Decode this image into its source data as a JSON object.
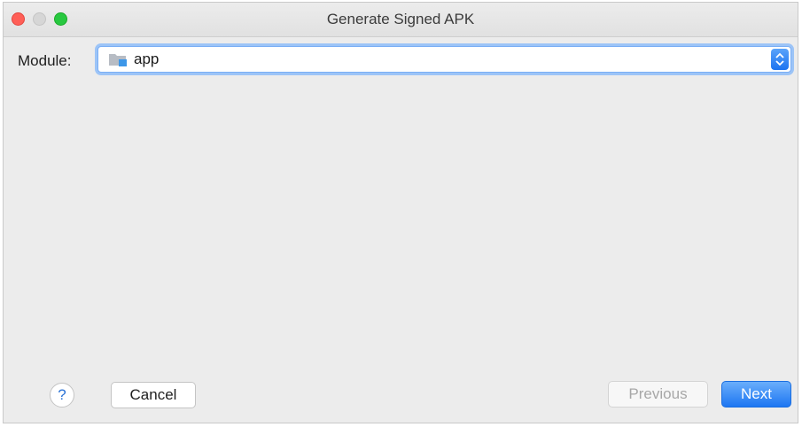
{
  "window": {
    "title": "Generate Signed APK"
  },
  "module": {
    "label": "Module:",
    "selected_value": "app",
    "icon": "module-folder-icon"
  },
  "footer": {
    "help_label": "?",
    "cancel_label": "Cancel",
    "previous_label": "Previous",
    "next_label": "Next"
  },
  "colors": {
    "accent": "#1d76f2",
    "close": "#ff5f57",
    "zoom": "#28c840",
    "disabled_text": "#a7a7a7"
  }
}
